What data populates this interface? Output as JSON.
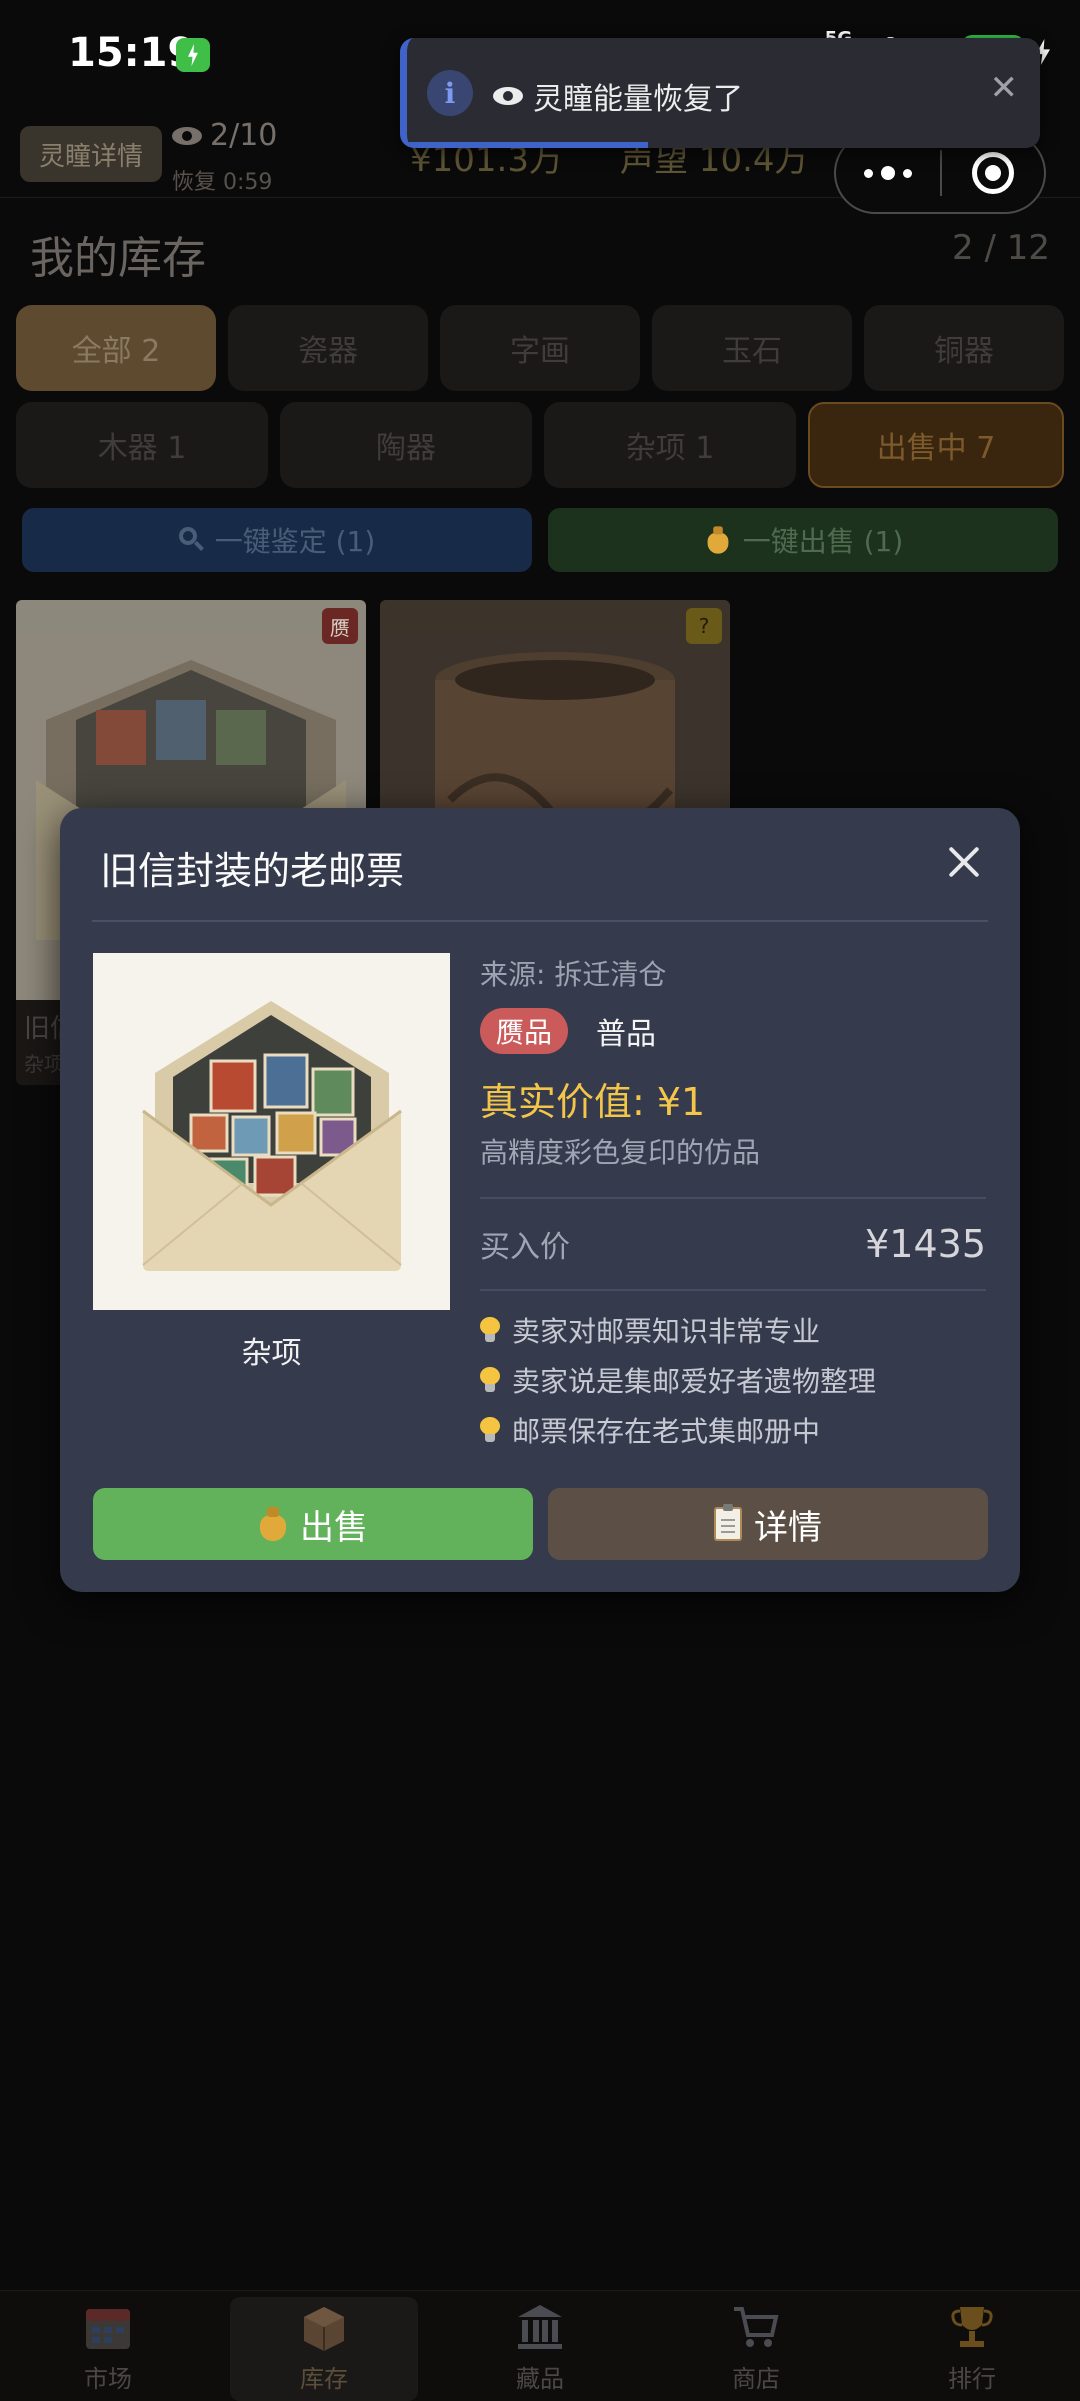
{
  "status": {
    "time": "15:19",
    "network": "5G",
    "battery": "98"
  },
  "toast": {
    "text": "灵瞳能量恢复了",
    "progress": 0.38
  },
  "header": {
    "lingtong_label": "灵瞳详情",
    "eye_count": "2/10",
    "recover": "恢复 0:59",
    "money": "¥101.3万",
    "reputation": "声望 10.4万"
  },
  "inventory": {
    "title": "我的库存",
    "count": "2 / 12",
    "tabs_row1": [
      "全部 2",
      "瓷器",
      "字画",
      "玉石",
      "铜器"
    ],
    "tabs_row2": [
      "木器 1",
      "陶器",
      "杂项 1",
      "出售中 7"
    ],
    "btn_appraise": "一键鉴定 (1)",
    "btn_sell_all": "一键出售 (1)",
    "items": [
      {
        "name": "旧信",
        "category": "杂项",
        "badge": "赝"
      },
      {
        "badge": "?"
      }
    ]
  },
  "modal": {
    "title": "旧信封装的老邮票",
    "category": "杂项",
    "source": "来源: 拆迁清仓",
    "tag_fake": "赝品",
    "grade": "普品",
    "true_value": "真实价值: ¥1",
    "true_desc": "高精度彩色复印的仿品",
    "buy_label": "买入价",
    "buy_price": "¥1435",
    "hints": [
      "卖家对邮票知识非常专业",
      "卖家说是集邮爱好者遗物整理",
      "邮票保存在老式集邮册中"
    ],
    "btn_sell": "出售",
    "btn_detail": "详情"
  },
  "nav": {
    "items": [
      {
        "label": "市场",
        "icon": "calendar-icon"
      },
      {
        "label": "库存",
        "icon": "package-icon"
      },
      {
        "label": "藏品",
        "icon": "museum-icon"
      },
      {
        "label": "商店",
        "icon": "cart-icon"
      },
      {
        "label": "排行",
        "icon": "trophy-icon"
      }
    ]
  }
}
